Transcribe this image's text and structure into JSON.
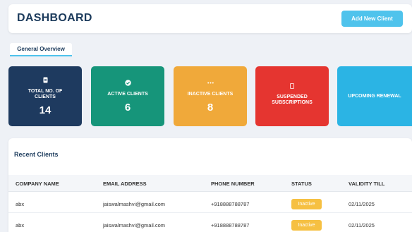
{
  "header": {
    "title": "DASHBOARD",
    "add_button": "Add New Client"
  },
  "tabs": [
    {
      "label": "General Overview",
      "active": true
    }
  ],
  "stats": [
    {
      "label": "TOTAL NO. OF CLIENTS",
      "value": "14",
      "icon": "file-icon",
      "color": "#1e3a5f"
    },
    {
      "label": "ACTIVE CLIENTS",
      "value": "6",
      "icon": "check-circle-icon",
      "color": "#16957a"
    },
    {
      "label": "INACTIVE CLIENTS",
      "value": "8",
      "icon": "ellipsis-icon",
      "color": "#f0a93a"
    },
    {
      "label": "SUSPENDED SUBSCRIPTIONS",
      "value": "",
      "icon": "blank-icon",
      "color": "#e53530"
    },
    {
      "label": "UPCOMING RENEWAL",
      "value": "",
      "icon": "",
      "color": "#2bb4e4"
    }
  ],
  "recent": {
    "title": "Recent Clients",
    "columns": [
      "COMPANY NAME",
      "EMAIL ADDRESS",
      "PHONE NUMBER",
      "STATUS",
      "VALIDITY TILL"
    ],
    "rows": [
      {
        "company": "abx",
        "email": "jaiswalmashvi@gmail.com",
        "phone": "+918888788787",
        "status": "Inactive",
        "validity": "02/11/2025"
      },
      {
        "company": "abx",
        "email": "jaiswalmashvi@gmail.com",
        "phone": "+918888788787",
        "status": "Inactive",
        "validity": "02/11/2025"
      }
    ]
  },
  "colors": {
    "accent": "#4fc3ec",
    "title": "#1c3b5c",
    "inactive_badge": "#f6c042",
    "background": "#eef1f6"
  }
}
